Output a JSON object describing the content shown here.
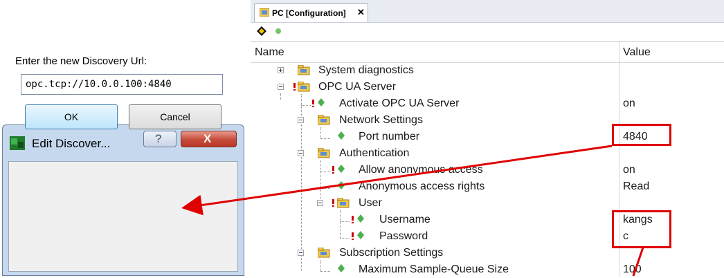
{
  "config_window": {
    "tab_title": "PC [Configuration]",
    "tab_close": "✕",
    "toolbar": {
      "back_icon": "arrow-diamond-icon",
      "status_icon": "green-dot-icon"
    },
    "columns": {
      "name": "Name",
      "value": "Value"
    },
    "rows": [
      {
        "label": "System diagnostics",
        "value": ""
      },
      {
        "label": "OPC UA Server",
        "value": ""
      },
      {
        "label": "Activate OPC UA Server",
        "value": "on"
      },
      {
        "label": "Network Settings",
        "value": ""
      },
      {
        "label": "Port number",
        "value": "4840"
      },
      {
        "label": "Authentication",
        "value": ""
      },
      {
        "label": "Allow anonymous access",
        "value": "on"
      },
      {
        "label": "Anonymous access rights",
        "value": "Read"
      },
      {
        "label": "User",
        "value": ""
      },
      {
        "label": "Username",
        "value": "kangs"
      },
      {
        "label": "Password",
        "value": "c"
      },
      {
        "label": "Subscription Settings",
        "value": ""
      },
      {
        "label": "Maximum Sample-Queue Size",
        "value": "100"
      }
    ]
  },
  "dialog": {
    "title": "Edit Discover...",
    "help": "?",
    "close": "X",
    "prompt": "Enter the new Discovery Url:",
    "url_value": "opc.tcp://10.0.0.100:4840",
    "ok_label": "OK",
    "cancel_label": "Cancel"
  },
  "colors": {
    "annotation_red": "#e00000",
    "folder_yellow": "#f2c94c",
    "leaf_green": "#4caf50",
    "warning_red": "#d30000"
  }
}
